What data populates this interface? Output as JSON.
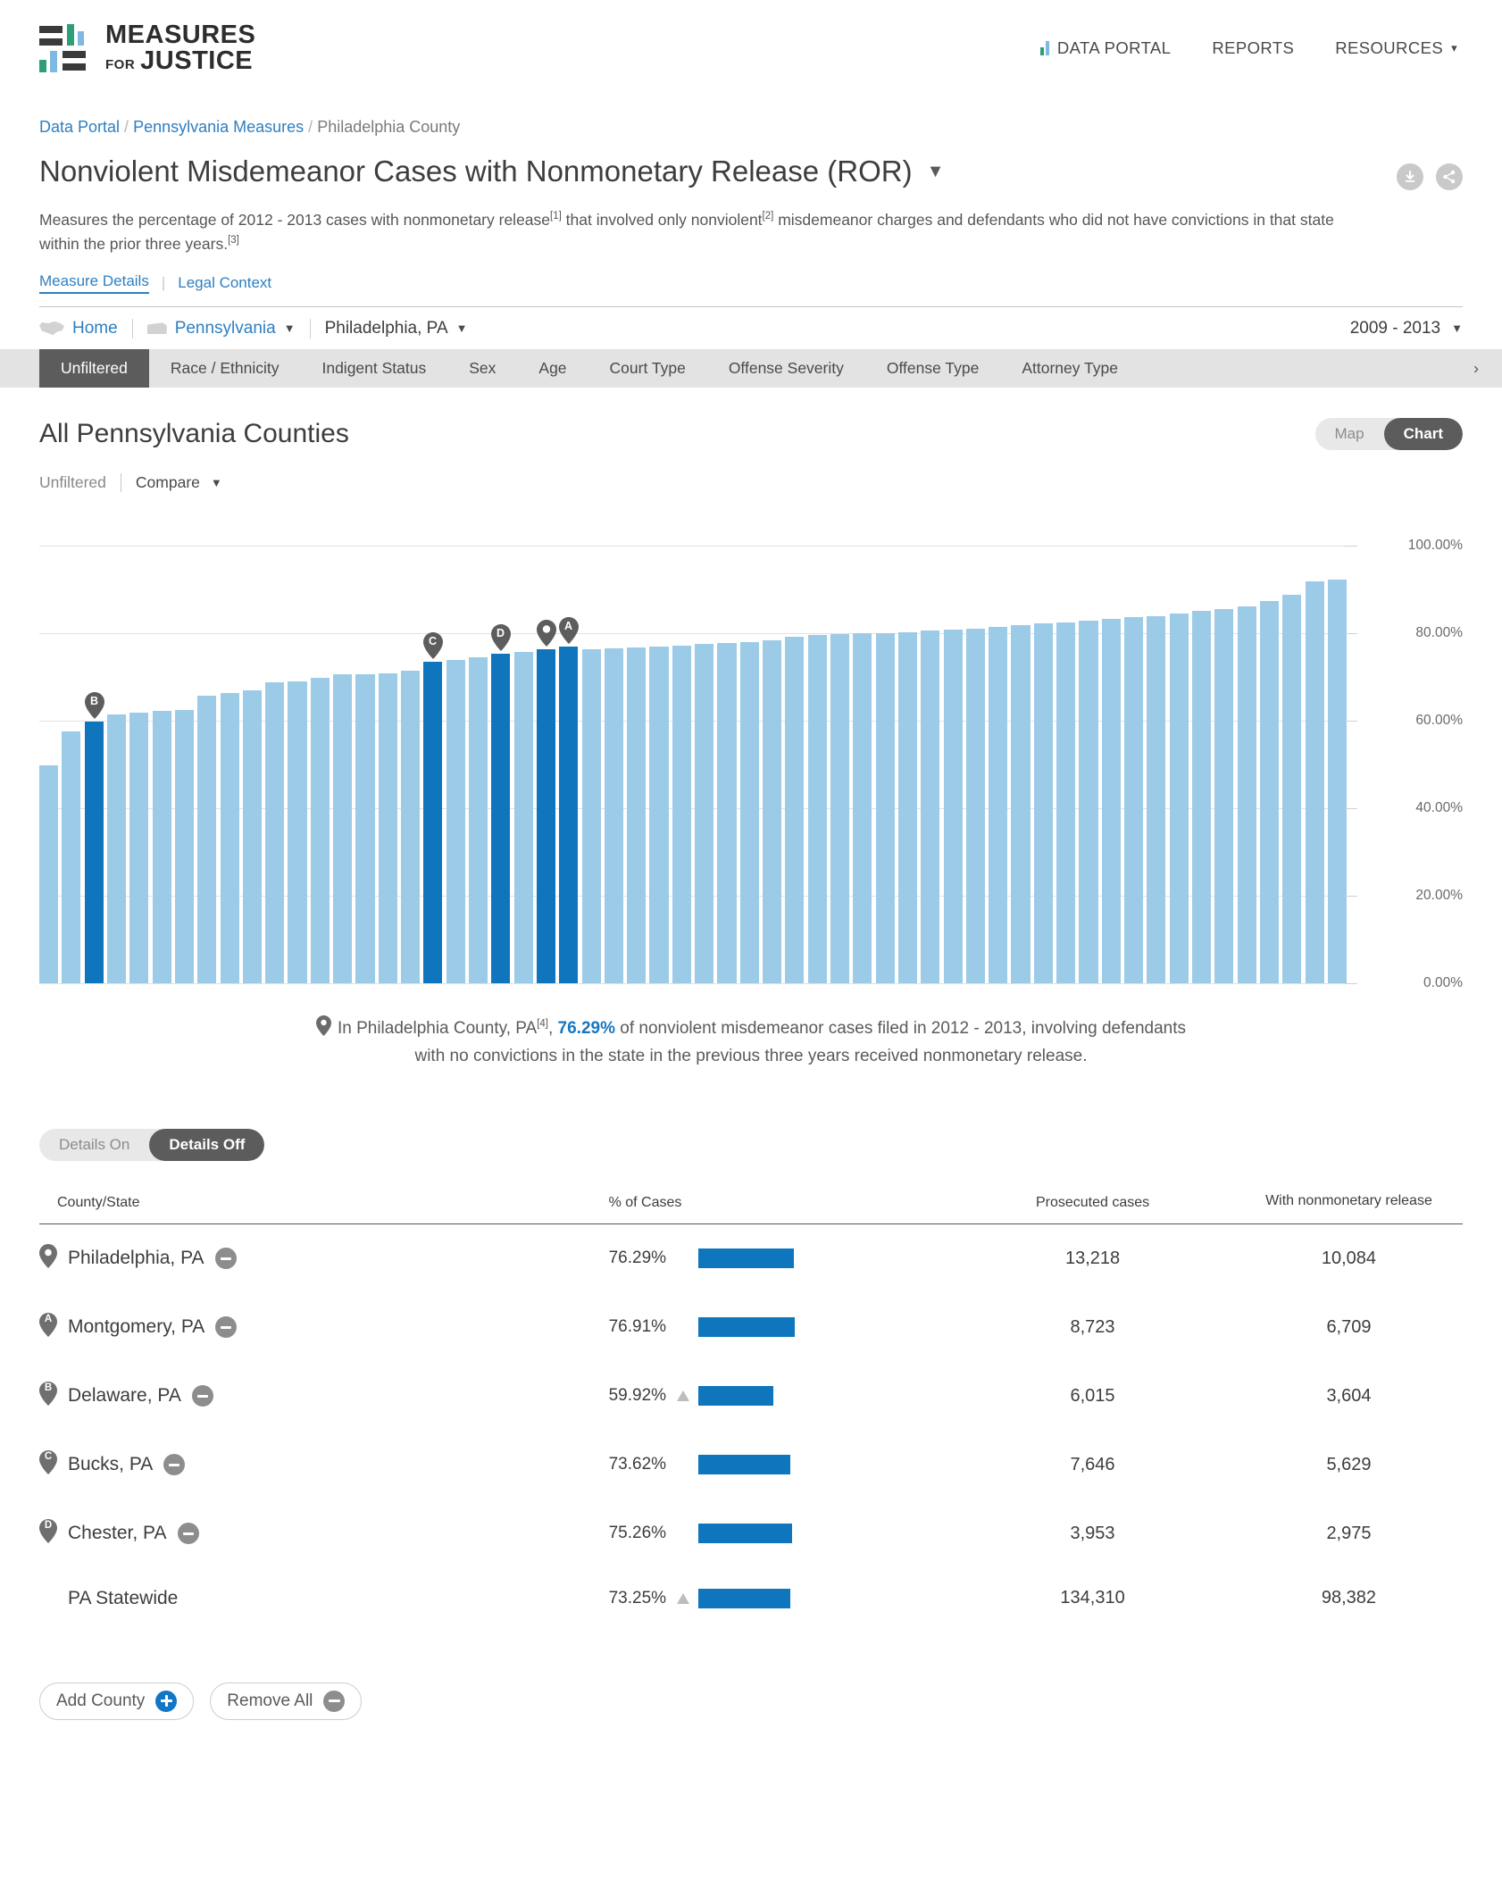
{
  "brand": {
    "line1": "MEASURES",
    "for": "FOR",
    "line2": "JUSTICE"
  },
  "nav": {
    "data_portal": "DATA PORTAL",
    "reports": "REPORTS",
    "resources": "RESOURCES"
  },
  "breadcrumb": {
    "item1": "Data Portal",
    "item2": "Pennsylvania Measures",
    "item3": "Philadelphia County",
    "sep": "/"
  },
  "measure": {
    "title": "Nonviolent Misdemeanor Cases with Nonmonetary Release (ROR)",
    "desc_1": "Measures the percentage of 2012 - 2013 cases with nonmonetary release",
    "sup_1": "[1]",
    "desc_2": " that involved only nonviolent",
    "sup_2": "[2]",
    "desc_3": " misdemeanor charges and defendants who did not have convictions in that state within the prior three years.",
    "sup_3": "[3]",
    "link_details": "Measure Details",
    "link_legal": "Legal Context",
    "divider": "|"
  },
  "location": {
    "home": "Home",
    "state": "Pennsylvania",
    "county": "Philadelphia, PA",
    "years": "2009 - 2013"
  },
  "filter_tabs": [
    {
      "label": "Unfiltered",
      "active": true
    },
    {
      "label": "Race / Ethnicity",
      "active": false
    },
    {
      "label": "Indigent Status",
      "active": false
    },
    {
      "label": "Sex",
      "active": false
    },
    {
      "label": "Age",
      "active": false
    },
    {
      "label": "Court Type",
      "active": false
    },
    {
      "label": "Offense Severity",
      "active": false
    },
    {
      "label": "Offense Type",
      "active": false
    },
    {
      "label": "Attorney Type",
      "active": false
    }
  ],
  "filter_more": "›",
  "section": {
    "title": "All Pennsylvania Counties",
    "view_map": "Map",
    "view_chart": "Chart",
    "unfiltered": "Unfiltered",
    "compare": "Compare"
  },
  "caption": {
    "pre": "In Philadelphia County, PA",
    "sup": "[4]",
    "comma": ", ",
    "pct": "76.29%",
    "post": " of nonviolent misdemeanor cases filed in 2012 - 2013, involving defendants with no convictions in the state in the previous three years received nonmonetary release."
  },
  "details": {
    "on": "Details On",
    "off": "Details Off"
  },
  "table": {
    "headers": {
      "county": "County/State",
      "pct": "% of Cases",
      "prosecuted": "Prosecuted cases",
      "release": "With nonmonetary release"
    },
    "rows": [
      {
        "pin": "",
        "name": "Philadelphia, PA",
        "pct": "76.29%",
        "pct_val": 76.29,
        "warn": false,
        "prosecuted": "13,218",
        "release": "10,084"
      },
      {
        "pin": "A",
        "name": "Montgomery, PA",
        "pct": "76.91%",
        "pct_val": 76.91,
        "warn": false,
        "prosecuted": "8,723",
        "release": "6,709"
      },
      {
        "pin": "B",
        "name": "Delaware, PA",
        "pct": "59.92%",
        "pct_val": 59.92,
        "warn": true,
        "prosecuted": "6,015",
        "release": "3,604"
      },
      {
        "pin": "C",
        "name": "Bucks, PA",
        "pct": "73.62%",
        "pct_val": 73.62,
        "warn": false,
        "prosecuted": "7,646",
        "release": "5,629"
      },
      {
        "pin": "D",
        "name": "Chester, PA",
        "pct": "75.26%",
        "pct_val": 75.26,
        "warn": false,
        "prosecuted": "3,953",
        "release": "2,975"
      },
      {
        "pin": null,
        "name": "PA Statewide",
        "pct": "73.25%",
        "pct_val": 73.25,
        "warn": true,
        "prosecuted": "134,310",
        "release": "98,382"
      }
    ]
  },
  "buttons": {
    "add_county": "Add County",
    "remove_all": "Remove All"
  },
  "colors": {
    "accent_blue": "#1776bd",
    "bar_light": "#9ccbe8",
    "bar_highlight": "#0f76bd",
    "brand_green": "#2e9e78",
    "brand_blue": "#7db9e0",
    "dark_gray": "#5c5c5c"
  },
  "chart_data": {
    "type": "bar",
    "title": "All Pennsylvania Counties",
    "xlabel": "",
    "ylabel": "",
    "ylim": [
      0,
      100
    ],
    "grid": true,
    "ytick_labels": [
      "100.00%",
      "80.00%",
      "60.00%",
      "40.00%",
      "20.00%",
      "0.00%"
    ],
    "yticks": [
      100,
      80,
      60,
      40,
      20,
      0
    ],
    "sort": "ascending",
    "highlight_color": "#0f76bd",
    "default_color": "#9ccbe8",
    "values": [
      49.8,
      57.6,
      59.92,
      61.4,
      61.8,
      62.2,
      62.6,
      65.8,
      66.3,
      67.0,
      68.8,
      69.1,
      69.8,
      70.6,
      70.7,
      70.8,
      71.4,
      73.62,
      73.9,
      74.5,
      75.26,
      75.7,
      76.29,
      76.91,
      76.4,
      76.6,
      76.8,
      77.0,
      77.2,
      77.6,
      77.9,
      78.1,
      78.4,
      79.2,
      79.6,
      79.8,
      80.0,
      80.1,
      80.3,
      80.6,
      80.9,
      81.1,
      81.5,
      81.9,
      82.4,
      82.6,
      83.0,
      83.4,
      83.7,
      84.0,
      84.6,
      85.1,
      85.5,
      86.1,
      87.4,
      88.9,
      91.8,
      92.2
    ],
    "highlighted_indices": [
      2,
      17,
      20,
      22,
      23
    ],
    "markers": [
      {
        "label": "B",
        "index": 2,
        "value": 59.92,
        "county": "Delaware, PA"
      },
      {
        "label": "C",
        "index": 17,
        "value": 73.62,
        "county": "Bucks, PA"
      },
      {
        "label": "D",
        "index": 20,
        "value": 75.26,
        "county": "Chester, PA"
      },
      {
        "label": "",
        "index": 22,
        "value": 76.29,
        "county": "Philadelphia, PA"
      },
      {
        "label": "A",
        "index": 23,
        "value": 76.91,
        "county": "Montgomery, PA"
      }
    ]
  }
}
